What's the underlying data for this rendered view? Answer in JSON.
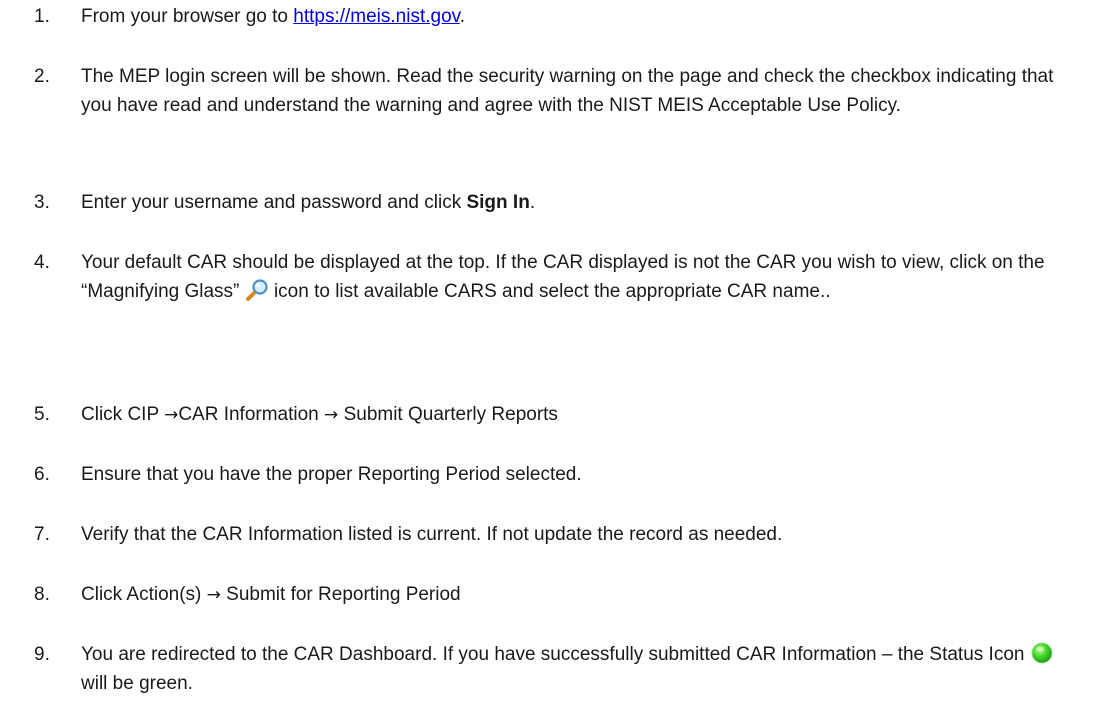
{
  "steps": [
    {
      "number": "1.",
      "pre": "From your browser go to ",
      "link": "https://meis.nist.gov",
      "post": "."
    },
    {
      "number": "2.",
      "text": "The MEP login screen will be shown.  Read the security warning on the page and check the checkbox indicating that you have read and understand the warning and agree with the NIST MEIS Acceptable Use Policy."
    },
    {
      "number": "3.",
      "pre": "Enter your username and password and click ",
      "bold": "Sign In",
      "post": "."
    },
    {
      "number": "4.",
      "pre": "Your default CAR should be displayed at the top.  If the CAR displayed is not the CAR you wish to view, click on the “Magnifying Glass” ",
      "icon": "magnifying-glass-icon",
      "post": " icon to list available CARS and select the appropriate CAR name.."
    },
    {
      "number": "5.",
      "a": "Click CIP ",
      "b": "CAR Information ",
      "c": " Submit Quarterly Reports",
      "arrow": "→"
    },
    {
      "number": "6.",
      "text": "Ensure that you have the proper Reporting Period selected."
    },
    {
      "number": "7.",
      "text": "Verify that the CAR Information listed is current.  If not update the record  as needed."
    },
    {
      "number": "8.",
      "a": "Click Action(s) ",
      "b": " Submit for Reporting Period",
      "arrow": "→"
    },
    {
      "number": "9.",
      "pre": "You are redirected to the CAR Dashboard. If you have successfully submitted CAR Information – the Status Icon ",
      "icon": "green-status-icon",
      "post": " will be green."
    }
  ],
  "colors": {
    "link": "#0000ee",
    "text": "#1a1a1a",
    "status_green": "#2fc81e"
  }
}
